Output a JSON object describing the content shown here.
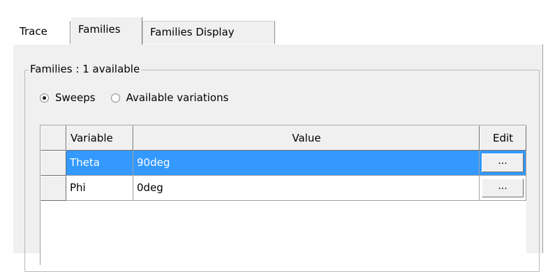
{
  "tabs": [
    {
      "label": "Trace",
      "active": false
    },
    {
      "label": "Families",
      "active": true
    },
    {
      "label": "Families Display",
      "active": false
    }
  ],
  "group": {
    "title": "Families : 1 available"
  },
  "radios": [
    {
      "label": "Sweeps",
      "checked": true
    },
    {
      "label": "Available variations",
      "checked": false
    }
  ],
  "grid": {
    "headers": {
      "variable": "Variable",
      "value": "Value",
      "edit": "Edit"
    },
    "rows": [
      {
        "variable": "Theta",
        "value": "90deg",
        "edit": "...",
        "selected": true
      },
      {
        "variable": "Phi",
        "value": "0deg",
        "edit": "...",
        "selected": false
      }
    ]
  },
  "colors": {
    "selection": "#3399ff",
    "face": "#f0f0f0"
  }
}
